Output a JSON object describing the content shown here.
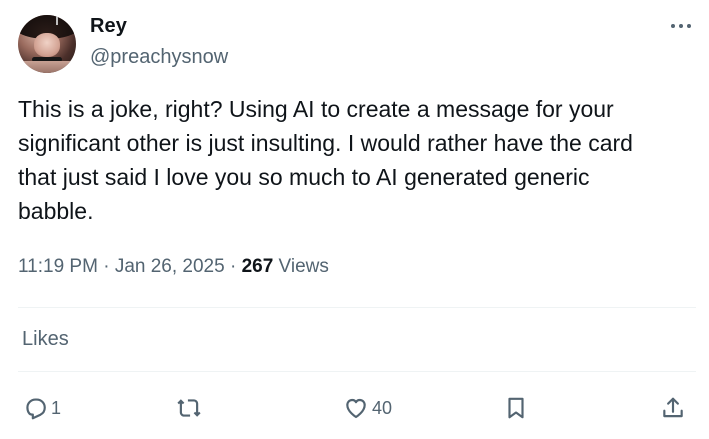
{
  "author": {
    "name": "Rey",
    "handle": "@preachysnow"
  },
  "tweet": {
    "text": "This is a joke, right? Using AI to create a message for your\nsignificant other is just insulting. I would rather have the card\nthat just said I love you so much to AI generated generic\nbabble."
  },
  "meta": {
    "time": "11:19 PM",
    "separator1": " · ",
    "date": "Jan 26, 2025",
    "separator2": " · ",
    "views_count": "267",
    "views_label": " Views"
  },
  "likes_tab": {
    "label": "Likes"
  },
  "actions": {
    "reply_count": "1",
    "retweet_count": "",
    "like_count": "40"
  },
  "icons": {
    "more": "more-icon",
    "reply": "reply-icon",
    "retweet": "retweet-icon",
    "like": "heart-icon",
    "bookmark": "bookmark-icon",
    "share": "share-icon"
  },
  "colors": {
    "text": "#0f1419",
    "secondary": "#536471",
    "divider": "#eff3f4"
  }
}
